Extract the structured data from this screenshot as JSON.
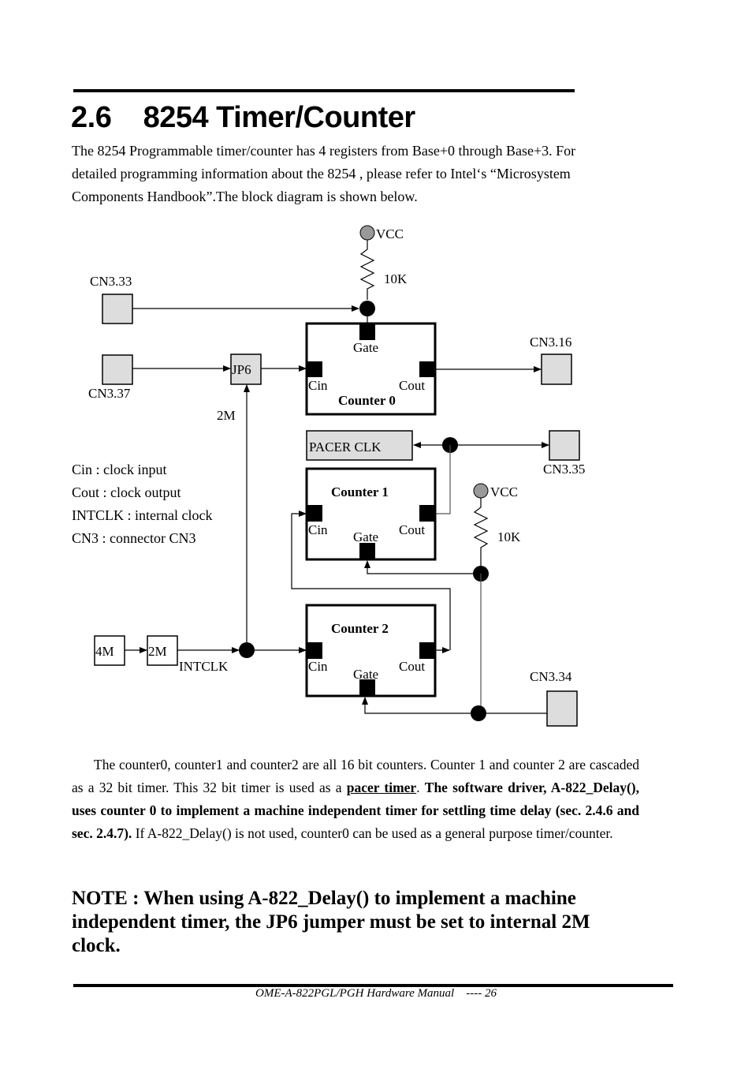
{
  "section": {
    "number": "2.6",
    "title": "8254 Timer/Counter"
  },
  "intro": "The 8254 Programmable timer/counter has 4 registers from Base+0 through Base+3. For detailed programming information about the 8254 , please refer to Intel‘s “Microsystem Components Handbook”.The block diagram is shown below.",
  "diagram": {
    "vcc_top": "VCC",
    "res_top": "10K",
    "vcc_mid": "VCC",
    "res_mid": "10K",
    "connectors": {
      "cn3_33": "CN3.33",
      "cn3_37": "CN3.37",
      "cn3_16": "CN3.16",
      "cn3_35": "CN3.35",
      "cn3_34": "CN3.34"
    },
    "jp6": "JP6",
    "label_2m_wire": "2M",
    "pacer_clk": "PACER CLK",
    "osc_4m": "4M",
    "div_2m": "2M",
    "intclk": "INTCLK",
    "counters": [
      {
        "name": "Counter 0",
        "gate": "Gate",
        "cin": "Cin",
        "cout": "Cout"
      },
      {
        "name": "Counter 1",
        "gate": "Gate",
        "cin": "Cin",
        "cout": "Cout"
      },
      {
        "name": "Counter 2",
        "gate": "Gate",
        "cin": "Cin",
        "cout": "Cout"
      }
    ]
  },
  "legend": [
    "Cin : clock input",
    "Cout : clock output",
    "INTCLK : internal clock",
    "CN3 : connector CN3"
  ],
  "body": {
    "part1": "The counter0, counter1 and counter2 are all 16 bit counters. Counter 1 and counter 2 are cascaded as a 32 bit timer. This 32 bit timer is used as a ",
    "link": "pacer timer",
    "part2": ". ",
    "bold": "The software driver, A-822_Delay(), uses counter 0 to implement a machine independent timer for settling time delay (sec. 2.4.6 and sec. 2.4.7).",
    "part3": " If A-822_Delay() is not used, counter0 can be used as a general purpose timer/counter."
  },
  "note": "NOTE : When using A-822_Delay() to implement a machine independent timer, the JP6 jumper must be set to internal 2M clock.",
  "footer": "OME-A-822PGL/PGH Hardware Manual    ---- 26"
}
